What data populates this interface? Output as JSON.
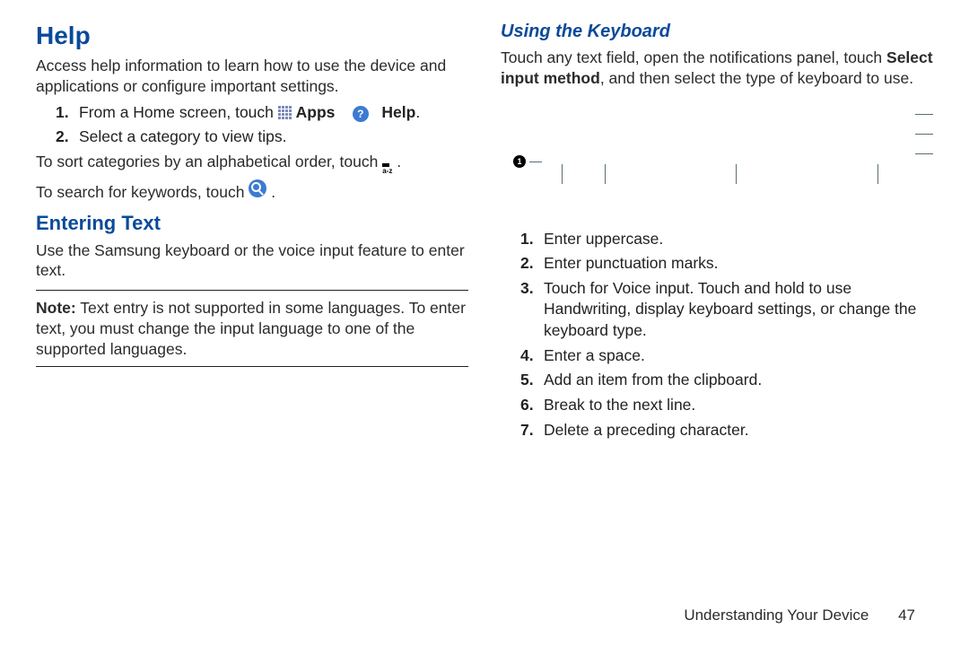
{
  "left": {
    "h1": "Help",
    "intro": "Access help information to learn how to use the device and applications or configure important settings.",
    "steps": [
      {
        "num": "1.",
        "pre": "From a Home screen, touch ",
        "apps": "Apps",
        "help": "Help",
        "post": "."
      },
      {
        "num": "2.",
        "text": "Select a category to view tips."
      }
    ],
    "sort_pre": "To sort categories by an alphabetical order, touch ",
    "sort_post": ".",
    "search_pre": "To search for keywords, touch ",
    "search_post": ".",
    "h2": "Entering Text",
    "enter_text": "Use the Samsung keyboard or the voice input feature to enter text.",
    "note_label": "Note:",
    "note": "Text entry is not supported in some languages. To enter text, you must change the input language to one of the supported languages."
  },
  "right": {
    "h1": "Using the Keyboard",
    "intro_pre": "Touch any text field, open the notifications panel, touch ",
    "intro_bold": "Select input method",
    "intro_post": ", and then select the type of keyboard to use.",
    "marker_1": "1",
    "list": [
      {
        "num": "1.",
        "text": "Enter uppercase."
      },
      {
        "num": "2.",
        "text": "Enter punctuation marks."
      },
      {
        "num": "3.",
        "text": "Touch for Voice input. Touch and hold to use Handwriting, display keyboard settings, or change the keyboard type."
      },
      {
        "num": "4.",
        "text": "Enter a space."
      },
      {
        "num": "5.",
        "text": "Add an item from the clipboard."
      },
      {
        "num": "6.",
        "text": "Break to the next line."
      },
      {
        "num": "7.",
        "text": "Delete a preceding character."
      }
    ]
  },
  "footer": {
    "section": "Understanding Your Device",
    "page": "47"
  }
}
